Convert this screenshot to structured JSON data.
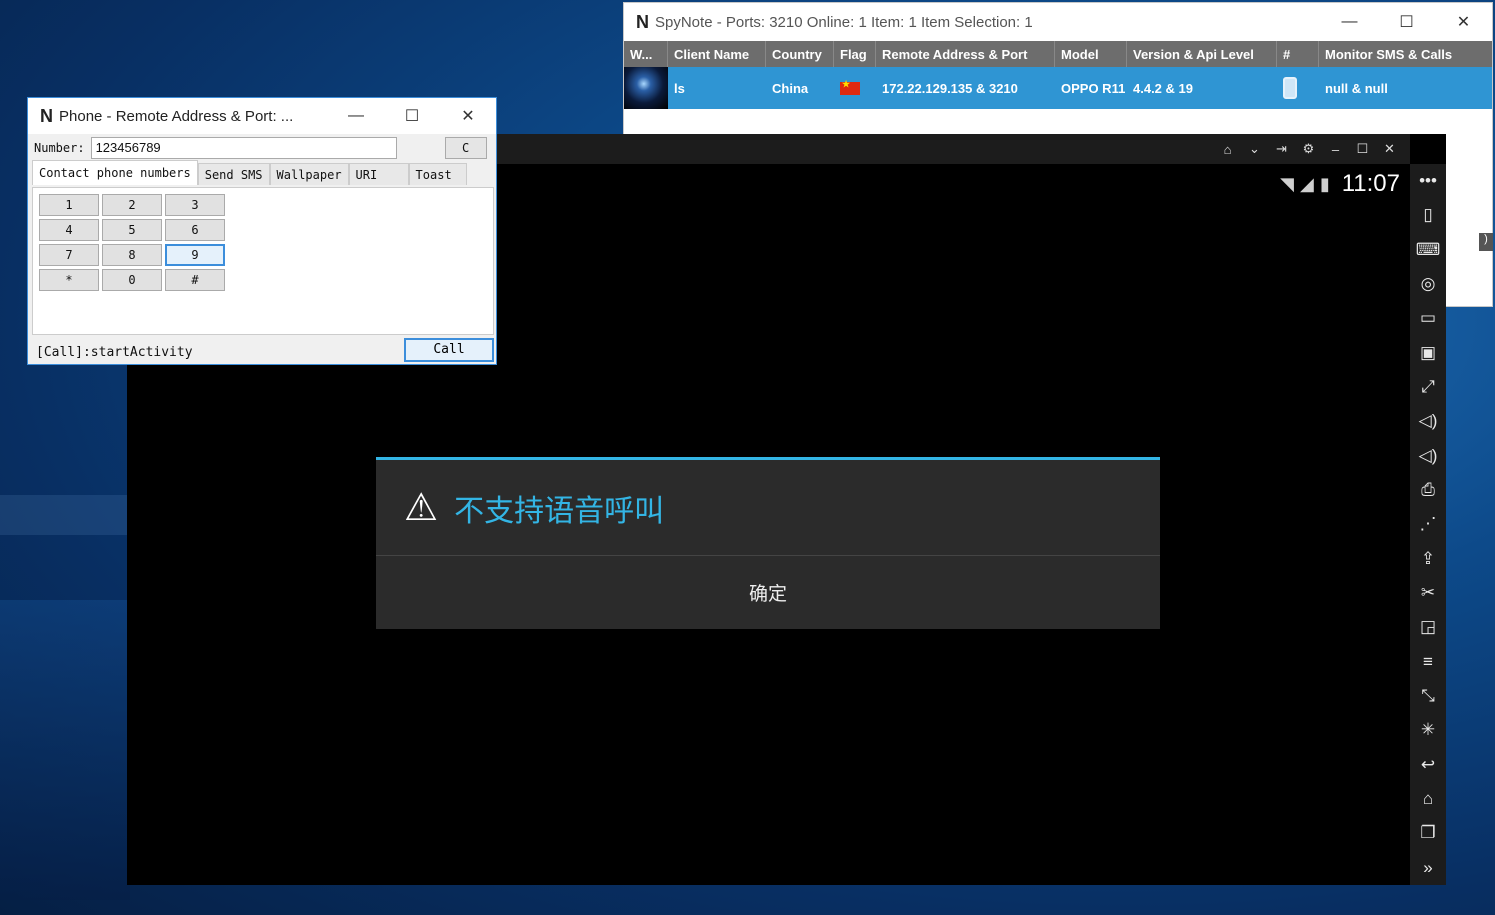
{
  "spynote": {
    "logo": "N",
    "title": "SpyNote - Ports: 3210 Online: 1 Item: 1 Item Selection: 1",
    "columns": [
      "W...",
      "Client Name",
      "Country",
      "Flag",
      "Remote Address & Port",
      "Model",
      "Version & Api Level",
      "#",
      "Monitor SMS & Calls"
    ],
    "row": {
      "client_name": "ls",
      "country": "China",
      "remote": "172.22.129.135 & 3210",
      "model": "OPPO R11",
      "version": "4.4.2 & 19",
      "monitor": "null & null"
    },
    "edge_tab": ")"
  },
  "window_controls": {
    "minimize": "—",
    "maximize": "☐",
    "close": "✕"
  },
  "phone": {
    "logo": "N",
    "title": "Phone - Remote Address & Port: ...",
    "number_label": "Number:",
    "number_value": "123456789",
    "clear_label": "C",
    "tabs": [
      "Contact phone numbers",
      "Send SMS",
      "Wallpaper",
      "URI",
      "Toast"
    ],
    "keys": [
      "1",
      "2",
      "3",
      "4",
      "5",
      "6",
      "7",
      "8",
      "9",
      "*",
      "0",
      "#"
    ],
    "status": "[Call]:startActivity",
    "call_label": "Call"
  },
  "emulator": {
    "topbar_icons": [
      "⌂",
      "⌄",
      "⇥",
      "⚙",
      "–",
      "☐",
      "✕"
    ],
    "side_icons": [
      "•••",
      "▯",
      "⌨",
      "◎",
      "▭",
      "▣",
      "⤢",
      "◁)",
      "◁)",
      "⎙",
      "⋰",
      "⇪",
      "✂",
      "◲",
      "≡",
      "⤡",
      "✳",
      "↩",
      "⌂",
      "❐",
      "»"
    ],
    "time": "11:07",
    "dialog_title": "不支持语音呼叫",
    "dialog_button": "确定"
  }
}
